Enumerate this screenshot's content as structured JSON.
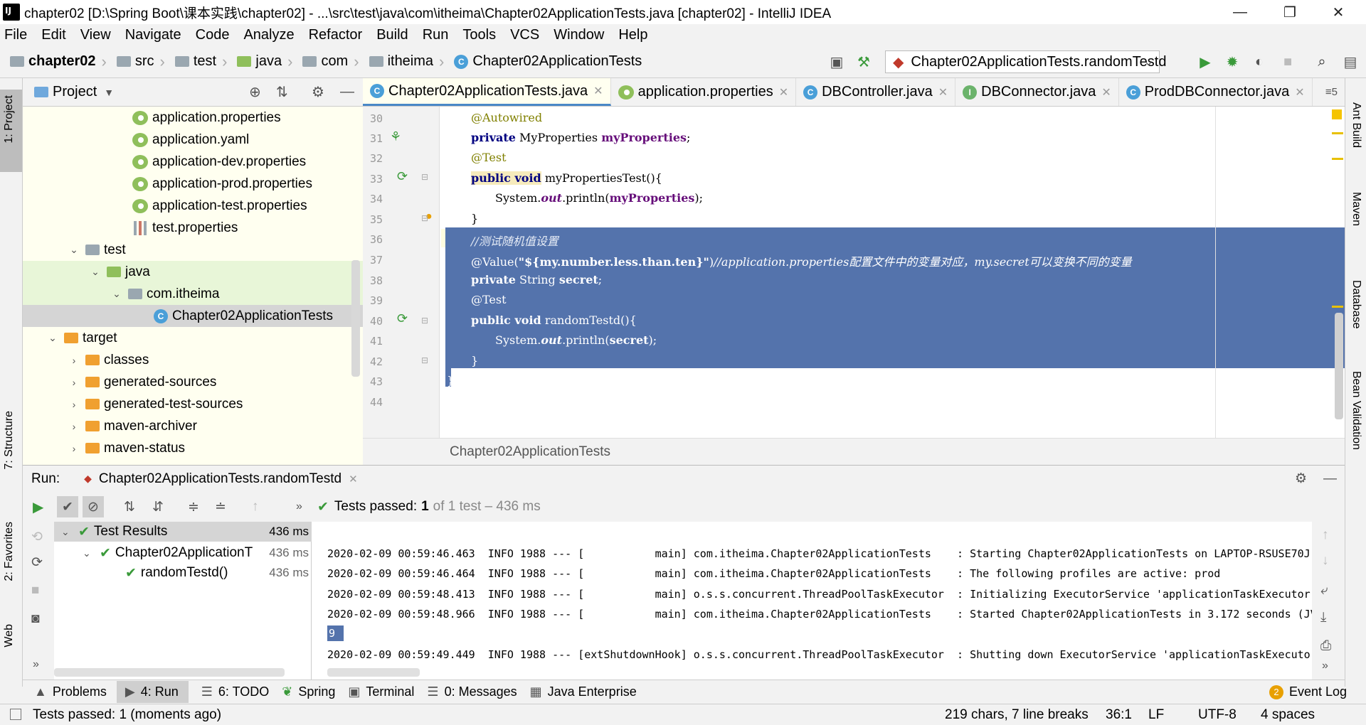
{
  "window": {
    "title": "chapter02 [D:\\Spring Boot\\课本实践\\chapter02] - ...\\src\\test\\java\\com\\itheima\\Chapter02ApplicationTests.java [chapter02] - IntelliJ IDEA",
    "minimize": "—",
    "restore": "❐",
    "close": "✕"
  },
  "menu": [
    "File",
    "Edit",
    "View",
    "Navigate",
    "Code",
    "Analyze",
    "Refactor",
    "Build",
    "Run",
    "Tools",
    "VCS",
    "Window",
    "Help"
  ],
  "breadcrumb": [
    "chapter02",
    "src",
    "test",
    "java",
    "com",
    "itheima",
    "Chapter02ApplicationTests"
  ],
  "run_config": "Chapter02ApplicationTests.randomTestd",
  "project_panel": {
    "title": "Project",
    "items": [
      {
        "label": "application.properties"
      },
      {
        "label": "application.yaml"
      },
      {
        "label": "application-dev.properties"
      },
      {
        "label": "application-prod.properties"
      },
      {
        "label": "application-test.properties"
      },
      {
        "label": "test.properties"
      },
      {
        "label": "test"
      },
      {
        "label": "java"
      },
      {
        "label": "com.itheima"
      },
      {
        "label": "Chapter02ApplicationTests"
      },
      {
        "label": "target"
      },
      {
        "label": "classes"
      },
      {
        "label": "generated-sources"
      },
      {
        "label": "generated-test-sources"
      },
      {
        "label": "maven-archiver"
      },
      {
        "label": "maven-status"
      }
    ]
  },
  "tabs": [
    {
      "label": "Chapter02ApplicationTests.java",
      "active": true
    },
    {
      "label": "application.properties"
    },
    {
      "label": "DBController.java"
    },
    {
      "label": "DBConnector.java"
    },
    {
      "label": "ProdDBConnector.java"
    }
  ],
  "tab_overflow": "≡5",
  "line_numbers": [
    "30",
    "31",
    "32",
    "33",
    "34",
    "35",
    "36",
    "37",
    "38",
    "39",
    "40",
    "41",
    "42",
    "43",
    "44"
  ],
  "code": {
    "l30": "@Autowired",
    "l31_kw": "private",
    "l31_type": "MyProperties",
    "l31_field": "myProperties",
    "l31_end": ";",
    "l32": "@Test",
    "l33_kw": "public void",
    "l33_rest": "myPropertiesTest(){",
    "l34_a": "System.",
    "l34_out": "out",
    "l34_b": ".println(",
    "l34_field": "myProperties",
    "l34_c": ");",
    "l35": "}",
    "l36": "//测试随机值设置",
    "l37_a": "@Value(",
    "l37_str": "\"${my.number.less.than.ten}\"",
    "l37_b": ")",
    "l37_cm": "//application.properties配置文件中的变量对应，my.secret可以变换不同的变量",
    "l38_kw": "private",
    "l38_rest": "String",
    "l38_field": "secret",
    "l38_end": ";",
    "l39": "@Test",
    "l40_kw": "public void",
    "l40_rest": "randomTestd(){",
    "l41_a": "System.",
    "l41_out": "out",
    "l41_b": ".println(",
    "l41_field": "secret",
    "l41_c": ");",
    "l42": "}",
    "l43": "}"
  },
  "editor_breadcrumb": "Chapter02ApplicationTests",
  "run_panel": {
    "label": "Run:",
    "tab": "Chapter02ApplicationTests.randomTestd",
    "status_prefix": "Tests passed:",
    "status_count": "1",
    "status_suffix": "of 1 test – 436 ms",
    "tree": [
      {
        "label": "Test Results",
        "time": "436 ms"
      },
      {
        "label": "Chapter02ApplicationT",
        "time": "436 ms"
      },
      {
        "label": "randomTestd()",
        "time": "436 ms"
      }
    ]
  },
  "console": [
    "2020-02-09 00:59:46.463  INFO 1988 --- [           main] com.itheima.Chapter02ApplicationTests    : Starting Chapter02ApplicationTests on LAPTOP-RSUSE70J",
    "2020-02-09 00:59:46.464  INFO 1988 --- [           main] com.itheima.Chapter02ApplicationTests    : The following profiles are active: prod",
    "2020-02-09 00:59:48.413  INFO 1988 --- [           main] o.s.s.concurrent.ThreadPoolTaskExecutor  : Initializing ExecutorService 'applicationTaskExecutor'",
    "2020-02-09 00:59:48.966  INFO 1988 --- [           main] com.itheima.Chapter02ApplicationTests    : Started Chapter02ApplicationTests in 3.172 seconds (JV",
    "9",
    "2020-02-09 00:59:49.449  INFO 1988 --- [extShutdownHook] o.s.s.concurrent.ThreadPoolTaskExecutor  : Shutting down ExecutorService 'applicationTaskExecutor"
  ],
  "bottom_tools": [
    "Problems",
    "4: Run",
    "6: TODO",
    "Spring",
    "Terminal",
    "0: Messages",
    "Java Enterprise"
  ],
  "event_log": {
    "count": "2",
    "label": "Event Log"
  },
  "status": {
    "left": "Tests passed: 1 (moments ago)",
    "chars": "219 chars, 7 line breaks",
    "pos": "36:1",
    "le": "LF",
    "enc": "UTF-8",
    "indent": "4 spaces"
  },
  "left_tabs": [
    "1: Project",
    "7: Structure",
    "2: Favorites",
    "Web"
  ],
  "right_tabs": [
    "Ant Build",
    "Maven",
    "Database",
    "Bean Validation"
  ],
  "colors": {
    "selection": "#5473ac",
    "accent": "#4a88c7",
    "pass": "#3a9a3a"
  }
}
